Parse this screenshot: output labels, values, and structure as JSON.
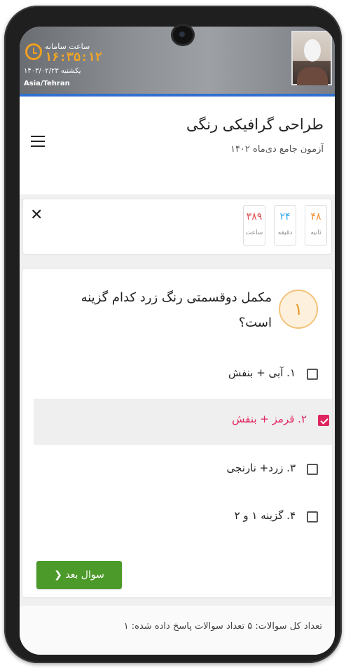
{
  "status": {
    "system_time_label": "ساعت سامانه",
    "system_time": "۱۶:۳۵:۱۲",
    "date": "یکشنبه ۱۴۰۳/۰۲/۲۳",
    "timezone": "Asia/Tehran"
  },
  "header": {
    "title": "طراحی گرافیکی رنگی",
    "subtitle": "آزمون جامع دی‌ماه ۱۴۰۲"
  },
  "timer": {
    "seconds": "۴۸",
    "seconds_label": "ثانیه",
    "minutes": "۲۴",
    "minutes_label": "دقیقه",
    "hours": "۳۸۹",
    "hours_label": "ساعت"
  },
  "question": {
    "number": "۱",
    "text": "مکمل دوقسمتی رنگ زرد کدام گزینه است؟",
    "options": [
      {
        "label": "۱. آبی + بنفش",
        "checked": false
      },
      {
        "label": "۲. قرمز + بنفش",
        "checked": true
      },
      {
        "label": "۳. زرد+ نارنجی",
        "checked": false
      },
      {
        "label": "۴. گزینه ۱ و ۲",
        "checked": false
      }
    ],
    "next_label": "سوال بعد ❮"
  },
  "footer": {
    "summary": "تعداد کل سوالات: ۵   تعداد سوالات پاسخ داده شده: ۱"
  },
  "colors": {
    "accent_blue": "#2f6fd0",
    "selected_red": "#e0245e",
    "next_green": "#4c9a2a",
    "clock_orange": "#f5a623"
  }
}
